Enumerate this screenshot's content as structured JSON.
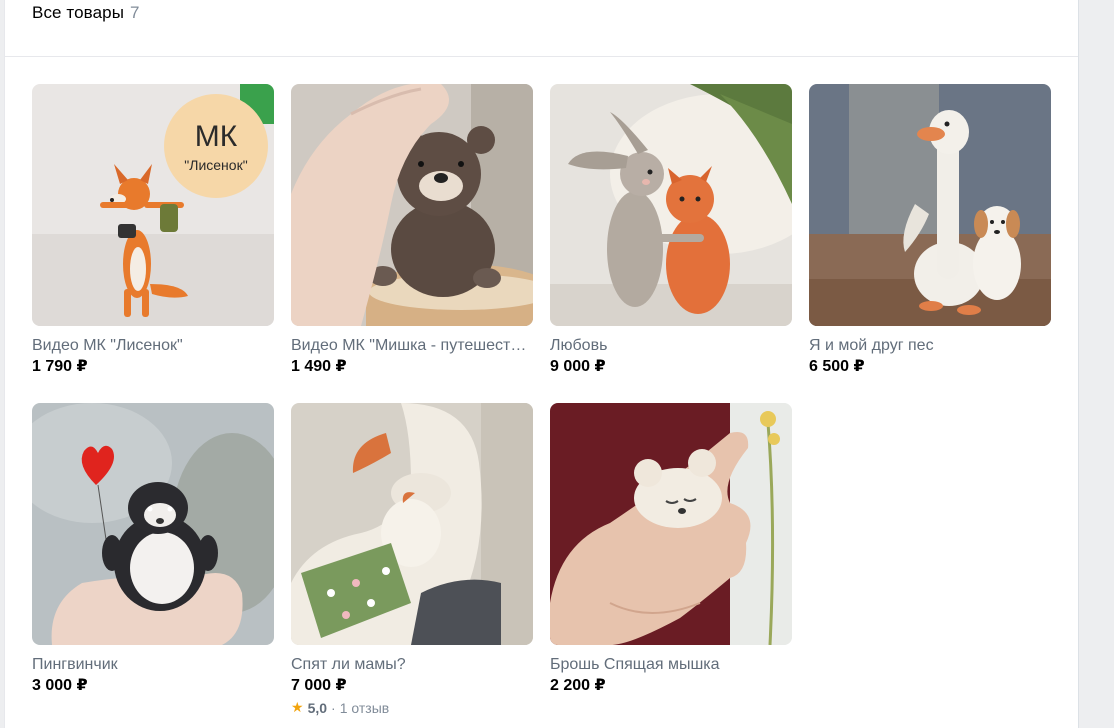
{
  "header": {
    "title": "Все товары",
    "count": "7"
  },
  "products": [
    {
      "title": "Видео МК \"Лисенок\"",
      "price": "1 790 ₽",
      "badge_top": "МК",
      "badge_bottom": "\"Лисенок\""
    },
    {
      "title": "Видео МК \"Мишка - путешественник\"",
      "price": "1 490 ₽"
    },
    {
      "title": "Любовь",
      "price": "9 000 ₽"
    },
    {
      "title": "Я и мой друг пес",
      "price": "6 500 ₽"
    },
    {
      "title": "Пингвинчик",
      "price": "3 000 ₽"
    },
    {
      "title": "Спят ли мамы?",
      "price": "7 000 ₽",
      "rating": {
        "score": "5,0",
        "separator": "·",
        "reviews": "1 отзыв"
      }
    },
    {
      "title": "Брошь Спящая мышка",
      "price": "2 200 ₽"
    }
  ],
  "colors": {
    "accent_star": "#f2a40e",
    "price": "#000000",
    "title": "#626d7a",
    "count": "#818c99"
  }
}
